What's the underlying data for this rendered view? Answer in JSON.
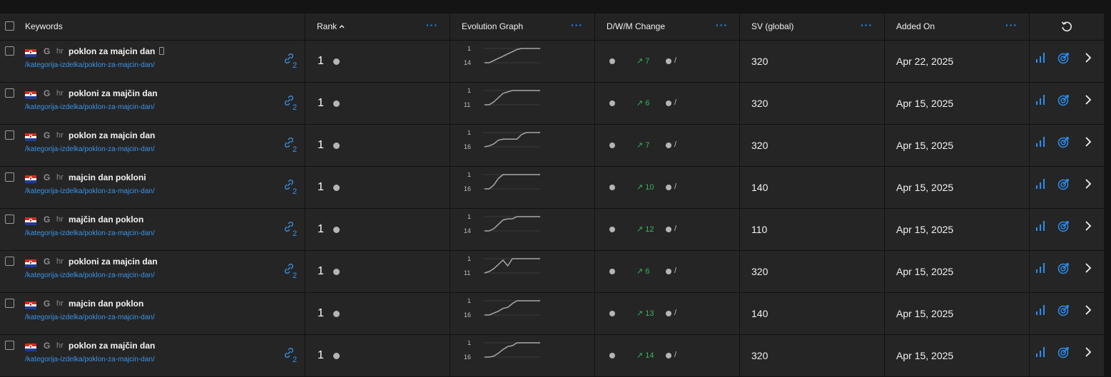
{
  "columns": {
    "keywords": "Keywords",
    "rank": "Rank",
    "rank_sort": "^",
    "evolution": "Evolution Graph",
    "dwm": "D/W/M Change",
    "sv": "SV (global)",
    "added": "Added On",
    "more": "···"
  },
  "icons": {
    "sort": "chevron-up-icon",
    "reset": "refresh-icon",
    "engine": "google-icon",
    "flag": "croatia-flag-icon",
    "link": "link-icon",
    "stats": "bar-chart-icon",
    "target": "target-icon",
    "expand": "chevron-right-icon"
  },
  "colors": {
    "accent": "#2b8ff0",
    "positive": "#38b45c"
  },
  "rows": [
    {
      "engine": "G",
      "lang": "hr",
      "keyword": "poklon za majcin dan",
      "mobile": true,
      "url": "/kategorija-izdelka/poklon-za-majcin-dan/",
      "links": "2",
      "rank": "1",
      "best": "1",
      "worst": "14",
      "trend": [
        14,
        14,
        12,
        10,
        8,
        6,
        4,
        2,
        1,
        1,
        1,
        1,
        1
      ],
      "change": "↗ 7",
      "monthly": "/",
      "sv": "320",
      "added": "Apr 22, 2025"
    },
    {
      "engine": "G",
      "lang": "hr",
      "keyword": "pokloni za majčin dan",
      "mobile": false,
      "url": "/kategorija-izdelka/poklon-za-majcin-dan/",
      "links": "2",
      "rank": "1",
      "best": "1",
      "worst": "11",
      "trend": [
        11,
        11,
        9,
        6,
        3,
        2,
        1,
        1,
        1,
        1,
        1,
        1,
        1
      ],
      "change": "↗ 6",
      "monthly": "/",
      "sv": "320",
      "added": "Apr 15, 2025"
    },
    {
      "engine": "G",
      "lang": "hr",
      "keyword": "poklon za majcin dan",
      "mobile": false,
      "url": "/kategorija-izdelka/poklon-za-majcin-dan/",
      "links": "2",
      "rank": "1",
      "best": "1",
      "worst": "16",
      "trend": [
        16,
        15,
        13,
        9,
        8,
        8,
        8,
        8,
        3,
        1,
        1,
        1,
        1
      ],
      "change": "↗ 7",
      "monthly": "/",
      "sv": "320",
      "added": "Apr 15, 2025"
    },
    {
      "engine": "G",
      "lang": "hr",
      "keyword": "majcin dan pokloni",
      "mobile": false,
      "url": "/kategorija-izdelka/poklon-za-majcin-dan/",
      "links": "2",
      "rank": "1",
      "best": "1",
      "worst": "16",
      "trend": [
        16,
        16,
        12,
        5,
        1,
        1,
        1,
        1,
        1,
        1,
        1,
        1,
        1
      ],
      "change": "↗ 10",
      "monthly": "/",
      "sv": "140",
      "added": "Apr 15, 2025"
    },
    {
      "engine": "G",
      "lang": "hr",
      "keyword": "majčin dan poklon",
      "mobile": false,
      "url": "/kategorija-izdelka/poklon-za-majcin-dan/",
      "links": "2",
      "rank": "1",
      "best": "1",
      "worst": "14",
      "trend": [
        14,
        14,
        12,
        8,
        4,
        3,
        3,
        1,
        1,
        1,
        1,
        1,
        1
      ],
      "change": "↗ 12",
      "monthly": "/",
      "sv": "110",
      "added": "Apr 15, 2025"
    },
    {
      "engine": "G",
      "lang": "hr",
      "keyword": "pokloni za majcin dan",
      "mobile": false,
      "url": "/kategorija-izdelka/poklon-za-majcin-dan/",
      "links": "2",
      "rank": "1",
      "best": "1",
      "worst": "11",
      "trend": [
        11,
        10,
        8,
        5,
        2,
        6,
        1,
        1,
        1,
        1,
        1,
        1,
        1
      ],
      "change": "↗ 6",
      "monthly": "/",
      "sv": "320",
      "added": "Apr 15, 2025"
    },
    {
      "engine": "G",
      "lang": "hr",
      "keyword": "majcin dan poklon",
      "mobile": false,
      "url": "/kategorija-izdelka/poklon-za-majcin-dan/",
      "links": "",
      "rank": "1",
      "best": "1",
      "worst": "16",
      "trend": [
        16,
        16,
        14,
        12,
        9,
        8,
        4,
        1,
        1,
        1,
        1,
        1,
        1
      ],
      "change": "↗ 13",
      "monthly": "/",
      "sv": "140",
      "added": "Apr 15, 2025"
    },
    {
      "engine": "G",
      "lang": "hr",
      "keyword": "poklon za majčin dan",
      "mobile": false,
      "url": "/kategorija-izdelka/poklon-za-majcin-dan/",
      "links": "2",
      "rank": "1",
      "best": "1",
      "worst": "16",
      "trend": [
        16,
        16,
        15,
        12,
        8,
        5,
        4,
        1,
        1,
        1,
        1,
        1,
        1
      ],
      "change": "↗ 14",
      "monthly": "/",
      "sv": "320",
      "added": "Apr 15, 2025"
    }
  ]
}
